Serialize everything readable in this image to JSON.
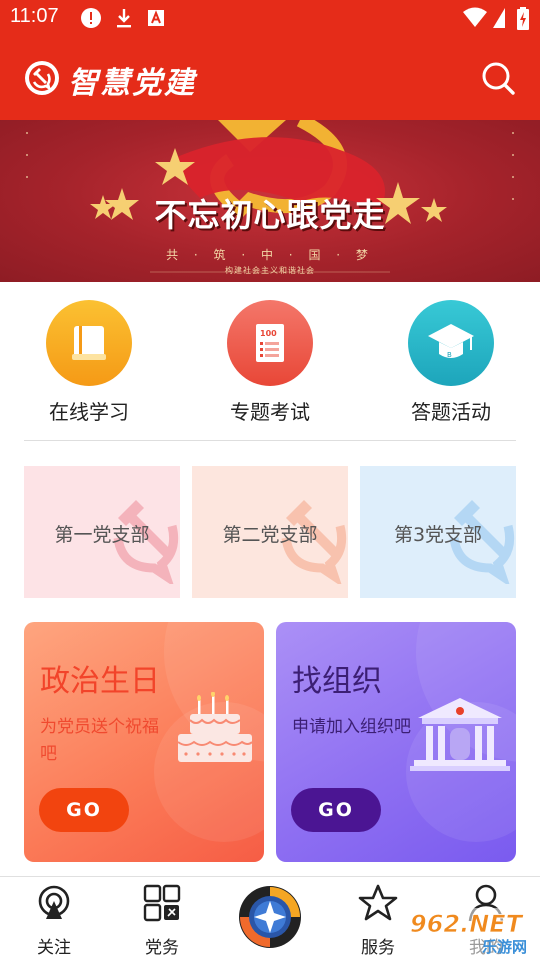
{
  "status_bar": {
    "time": "11:07"
  },
  "app_bar": {
    "title": "智慧党建"
  },
  "banner": {
    "headline": "不忘初心跟党走",
    "subtitle": "共 · 筑 · 中 · 国 · 梦",
    "tagline": "构建社会主义和谐社会"
  },
  "quick_actions": [
    {
      "label": "在线学习",
      "icon": "book-icon",
      "color": "#f8a91e"
    },
    {
      "label": "专题考试",
      "icon": "exam-paper-icon",
      "color": "#ef5a4a"
    },
    {
      "label": "答题活动",
      "icon": "graduation-cap-icon",
      "color": "#2bb6c8"
    }
  ],
  "branches": [
    {
      "label": "第一党支部",
      "color": "#fde3e6"
    },
    {
      "label": "第二党支部",
      "color": "#fde6de"
    },
    {
      "label": "第3党支部",
      "color": "#deeefb"
    }
  ],
  "cards": [
    {
      "title": "政治生日",
      "desc": "为党员送个祝福吧",
      "button": "GO"
    },
    {
      "title": "找组织",
      "desc": "申请加入组织吧",
      "button": "GO"
    }
  ],
  "bottom_nav": [
    {
      "label": "关注",
      "icon": "broadcast-icon"
    },
    {
      "label": "党务",
      "icon": "grid-icon"
    },
    {
      "label": "",
      "icon": "center-star-icon"
    },
    {
      "label": "服务",
      "icon": "star-icon"
    },
    {
      "label": "我的",
      "icon": "person-icon"
    }
  ],
  "watermark": {
    "text": "962.NET",
    "subtext": "乐游网"
  }
}
